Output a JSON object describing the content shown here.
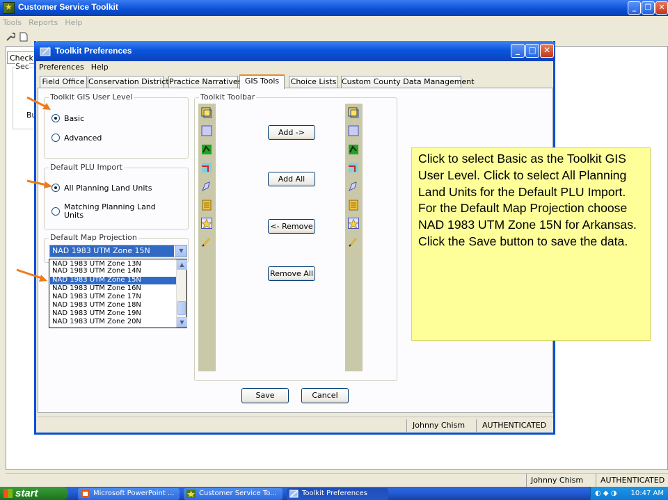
{
  "main_window": {
    "title": "Customer Service Toolkit",
    "menu": [
      "Tools",
      "Reports",
      "Help"
    ],
    "check_tab_label": "Check",
    "partial_labels": {
      "sec": "Sec",
      "bu": "Bu"
    },
    "status": {
      "user": "Johnny Chism",
      "auth": "AUTHENTICATED"
    }
  },
  "dialog": {
    "title": "Toolkit Preferences",
    "menu": [
      "Preferences",
      "Help"
    ],
    "tabs": [
      "Field Office",
      "Conservation District",
      "Practice Narratives",
      "GIS Tools",
      "Choice Lists",
      "Custom County Data Management"
    ],
    "active_tab": "GIS Tools",
    "gis_user_level": {
      "label": "Toolkit GIS User Level",
      "options": [
        "Basic",
        "Advanced"
      ],
      "selected": "Basic"
    },
    "plu_import": {
      "label": "Default PLU Import",
      "options": [
        "All Planning Land Units",
        "Matching Planning Land Units"
      ],
      "selected": "All Planning Land Units"
    },
    "map_projection": {
      "label": "Default Map Projection",
      "value": "NAD 1983 UTM Zone 15N",
      "options": [
        "NAD 1983 UTM Zone 13N",
        "NAD 1983 UTM Zone 14N",
        "NAD 1983 UTM Zone 15N",
        "NAD 1983 UTM Zone 16N",
        "NAD 1983 UTM Zone 17N",
        "NAD 1983 UTM Zone 18N",
        "NAD 1983 UTM Zone 19N",
        "NAD 1983 UTM Zone 20N"
      ],
      "highlighted": "NAD 1983 UTM Zone 15N"
    },
    "toolbar": {
      "label": "Toolkit Toolbar",
      "icons": [
        "select-feature-icon",
        "rectangle-icon",
        "map-layer-icon",
        "measure-icon",
        "edit-shape-icon",
        "attribute-table-icon",
        "star-icon",
        "pencil-icon"
      ],
      "buttons": {
        "add": "Add ->",
        "add_all": "Add All",
        "remove": "<- Remove",
        "remove_all": "Remove All"
      }
    },
    "footer_buttons": {
      "save": "Save",
      "cancel": "Cancel"
    },
    "status": {
      "user": "Johnny Chism",
      "auth": "AUTHENTICATED"
    }
  },
  "callout": {
    "text": "Click to select  Basic as the Toolkit GIS User Level. Click to select All Planning Land Units for the Default PLU Import. For the Default Map Projection choose NAD 1983 UTM Zone 15N for Arkansas. Click the Save button to save the data."
  },
  "taskbar": {
    "start_label": "start",
    "items": [
      "Microsoft PowerPoint ...",
      "Customer Service To...",
      "Toolkit Preferences"
    ],
    "clock": "10:47 AM"
  },
  "colors": {
    "xp_blue": "#0a4fd4",
    "callout_yellow": "#ffff99",
    "arrow_orange": "#f07a1a",
    "selection_blue": "#316ac5"
  }
}
